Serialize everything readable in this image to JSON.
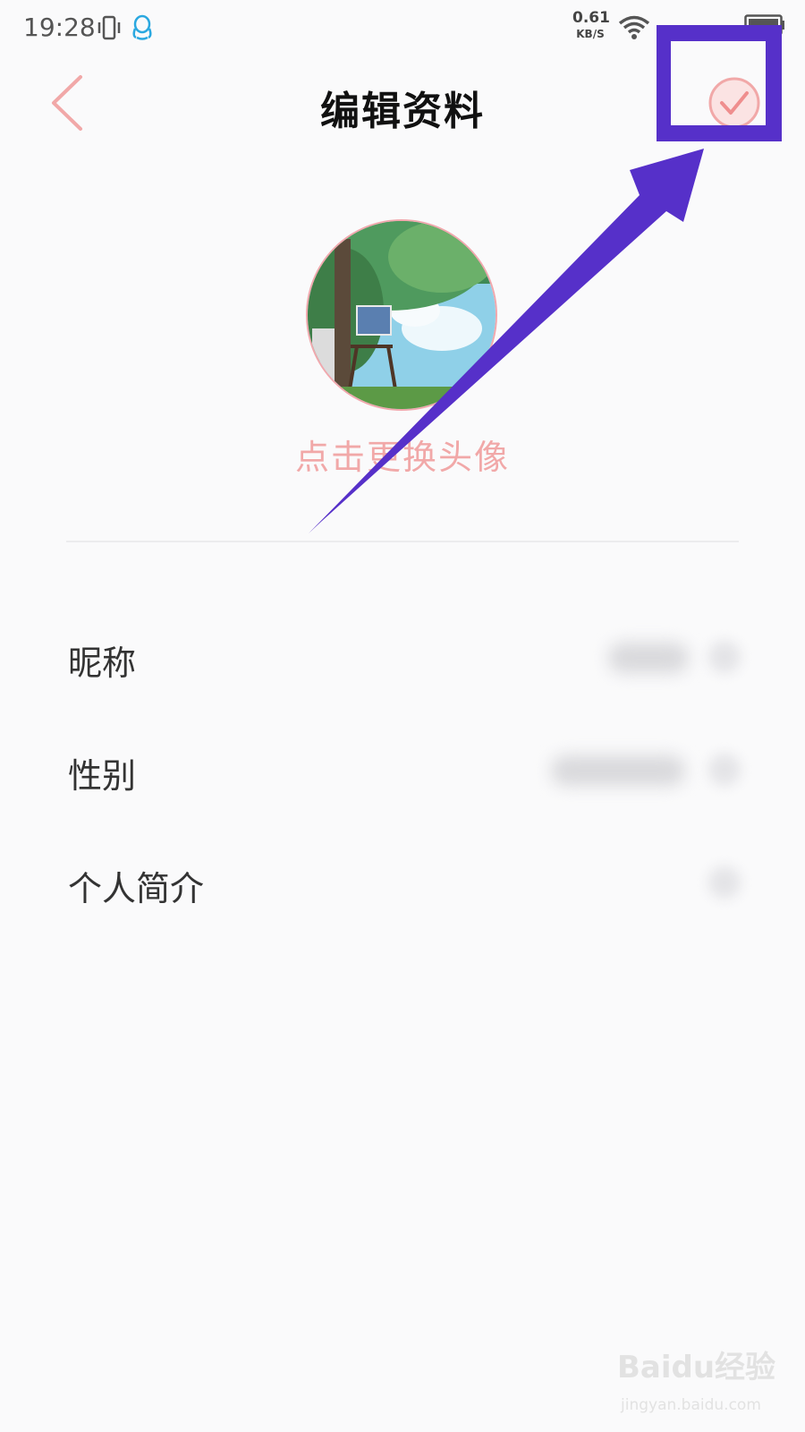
{
  "status_bar": {
    "time": "19:28",
    "net_speed_value": "0.61",
    "net_speed_unit": "KB/S",
    "icons": [
      "vibrate-icon",
      "qq-icon",
      "wifi-icon",
      "battery-icon"
    ]
  },
  "header": {
    "back_icon": "chevron-left-icon",
    "title": "编辑资料",
    "confirm_icon": "check-circle-icon"
  },
  "avatar": {
    "change_label": "点击更换头像"
  },
  "form": {
    "rows": [
      {
        "label": "昵称"
      },
      {
        "label": "性别"
      },
      {
        "label": "个人简介"
      }
    ]
  },
  "watermark": {
    "main": "Baidu经验",
    "sub": "jingyan.baidu.com"
  },
  "colors": {
    "accent": "#f1a8a8",
    "annotation": "#5630c9",
    "background": "#fafafb"
  }
}
